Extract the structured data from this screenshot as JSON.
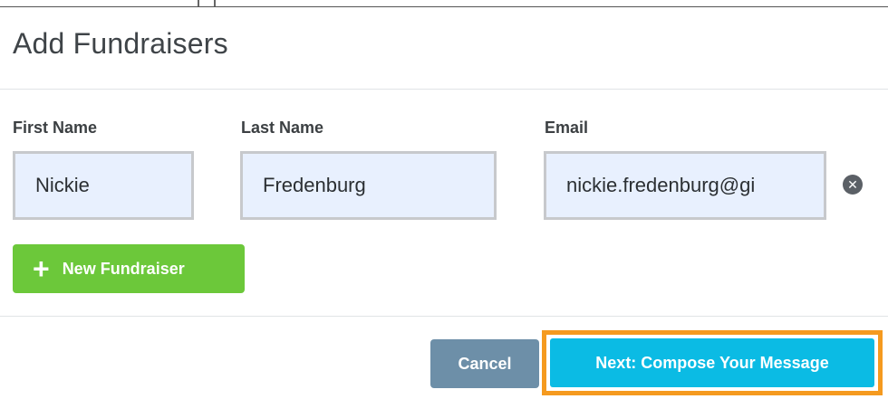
{
  "modal": {
    "title": "Add Fundraisers"
  },
  "form": {
    "columns": {
      "first_name_label": "First Name",
      "last_name_label": "Last Name",
      "email_label": "Email"
    },
    "rows": [
      {
        "first_name": "Nickie",
        "last_name": "Fredenburg",
        "email": "nickie.fredenburg@gi"
      }
    ],
    "remove_icon": "close-circle-icon",
    "new_fundraiser_icon": "plus-icon",
    "new_fundraiser_label": "New Fundraiser"
  },
  "footer": {
    "cancel_label": "Cancel",
    "next_label": "Next: Compose Your Message"
  },
  "colors": {
    "title_text": "#3f4448",
    "input_bg": "#e8f0fe",
    "input_border": "#c7c9cc",
    "new_button": "#6cc83a",
    "cancel_button": "#6d8fa8",
    "next_button": "#0bbbe4",
    "highlight_outline": "#f59a1f"
  }
}
